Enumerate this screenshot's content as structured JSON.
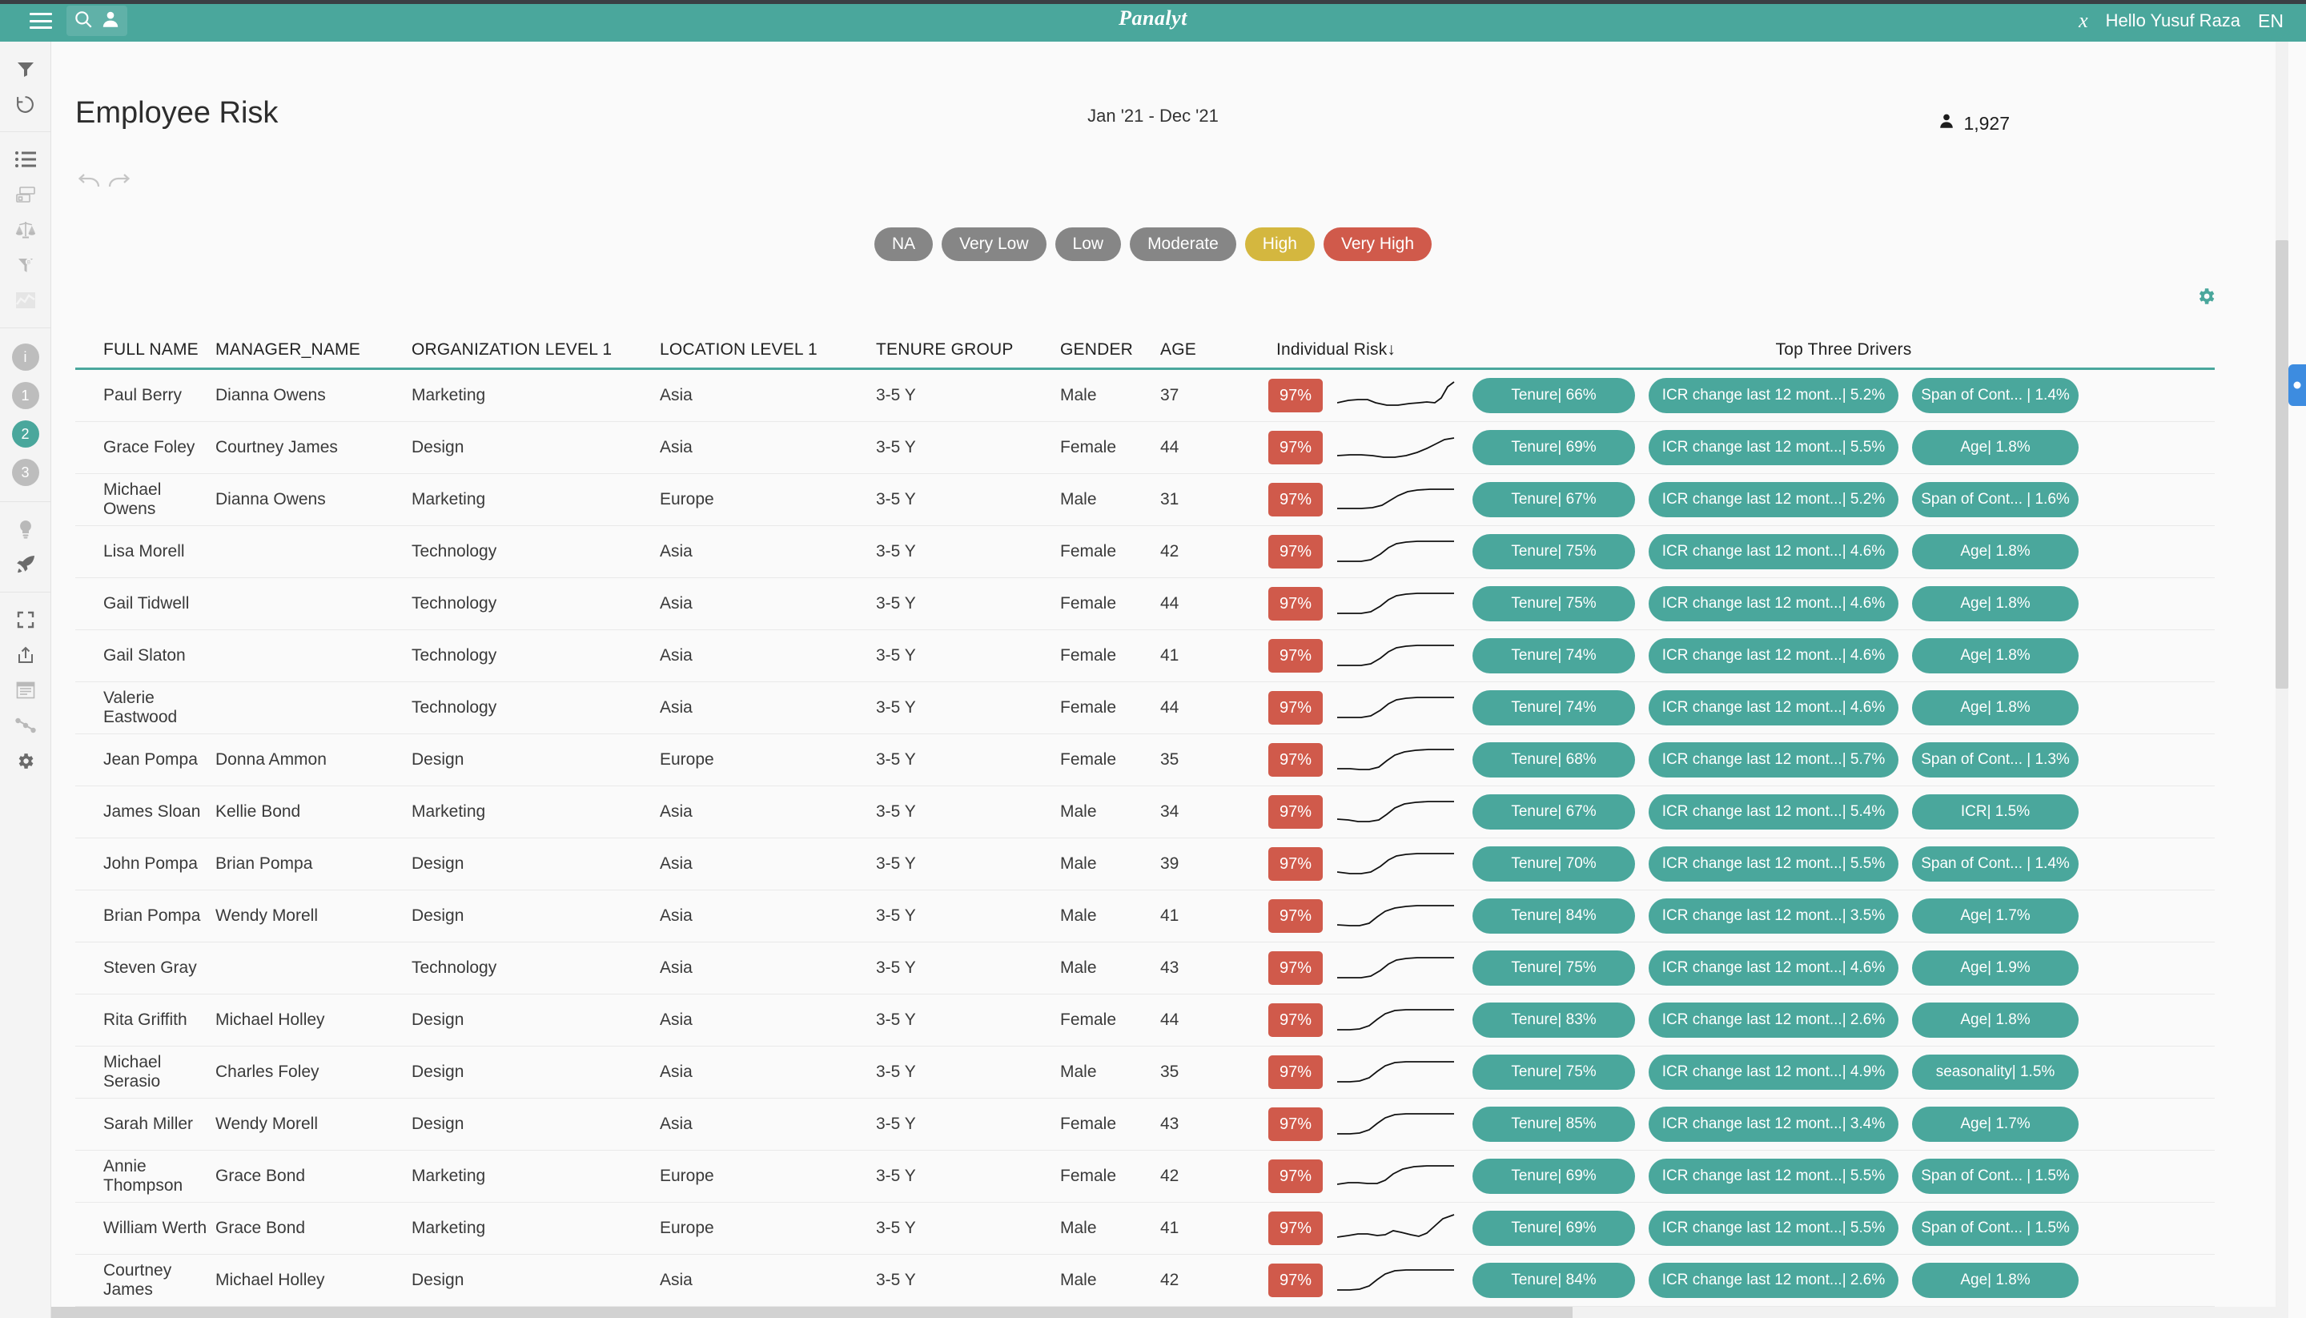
{
  "topbar": {
    "menu_icon": "hamburger-icon",
    "search_icon": "search-icon",
    "user_icon": "user-icon",
    "brand": "Panalyt",
    "leaf_icon": "leaf-icon",
    "greeting": "Hello Yusuf Raza",
    "language": "EN",
    "bg_color": "#4aa79c"
  },
  "rail": {
    "groups": [
      {
        "items": [
          {
            "name": "filter-icon",
            "label": "Filter"
          },
          {
            "name": "history-icon",
            "label": "History"
          }
        ]
      },
      {
        "items": [
          {
            "name": "list-icon",
            "label": "List"
          },
          {
            "name": "cards-icon",
            "label": "Cards"
          },
          {
            "name": "balance-icon",
            "label": "Compare"
          },
          {
            "name": "funnel-b-icon",
            "label": "Benchmark Funnel"
          },
          {
            "name": "chart-area-icon",
            "label": "Trends"
          }
        ]
      },
      {
        "badges": [
          {
            "label": "i",
            "active": false
          },
          {
            "label": "1",
            "active": false
          },
          {
            "label": "2",
            "active": true
          },
          {
            "label": "3",
            "active": false
          }
        ]
      },
      {
        "items": [
          {
            "name": "lightbulb-icon",
            "label": "Insights"
          },
          {
            "name": "rocket-icon",
            "label": "Actions"
          }
        ]
      },
      {
        "items": [
          {
            "name": "fullscreen-icon",
            "label": "Fullscreen"
          },
          {
            "name": "share-icon",
            "label": "Share"
          },
          {
            "name": "report-icon",
            "label": "Report"
          },
          {
            "name": "flow-icon",
            "label": "Flow"
          },
          {
            "name": "gear-icon",
            "label": "Settings"
          }
        ]
      }
    ]
  },
  "header": {
    "title": "Employee Risk",
    "date_range": "Jan '21 - Dec '21",
    "headcount": "1,927",
    "headcount_icon": "person-icon",
    "undo_icon": "undo-icon",
    "redo_icon": "redo-icon",
    "gear_icon": "gear-icon"
  },
  "legend": [
    {
      "label": "NA",
      "color": "#868686"
    },
    {
      "label": "Very Low",
      "color": "#868686"
    },
    {
      "label": "Low",
      "color": "#868686"
    },
    {
      "label": "Moderate",
      "color": "#868686"
    },
    {
      "label": "High",
      "color": "#d4b73f"
    },
    {
      "label": "Very High",
      "color": "#d05a4b"
    }
  ],
  "table": {
    "columns": [
      "FULL NAME",
      "MANAGER_NAME",
      "ORGANIZATION LEVEL 1",
      "LOCATION LEVEL 1",
      "TENURE GROUP",
      "GENDER",
      "AGE",
      "Individual Risk↓",
      "Top Three Drivers"
    ],
    "rows": [
      {
        "full_name": "Paul Berry",
        "manager": "Dianna Owens",
        "org": "Marketing",
        "loc": "Asia",
        "tenure": "3-5 Y",
        "gender": "Male",
        "age": "37",
        "risk": "97%",
        "spark": "0,30 14,27 26,26 38,26 48,30 62,33 76,33 90,31 102,30 112,29 122,30 130,24 138,10 146,4",
        "drivers": [
          "Tenure| 66%",
          "ICR change last 12 mont...| 5.2%",
          "Span of Cont... | 1.4%"
        ]
      },
      {
        "full_name": "Grace Foley",
        "manager": "Courtney James",
        "org": "Design",
        "loc": "Asia",
        "tenure": "3-5 Y",
        "gender": "Female",
        "age": "44",
        "risk": "97%",
        "spark": "0,31 16,30 30,30 44,31 58,33 72,33 86,31 100,27 112,22 124,16 134,11 146,9",
        "drivers": [
          "Tenure| 69%",
          "ICR change last 12 mont...| 5.5%",
          "Age| 1.8%"
        ]
      },
      {
        "full_name": "Michael Owens",
        "manager": "Dianna Owens",
        "org": "Marketing",
        "loc": "Europe",
        "tenure": "3-5 Y",
        "gender": "Male",
        "age": "31",
        "risk": "97%",
        "spark": "0,32 16,32 30,32 44,31 56,28 66,22 76,16 88,11 100,9 116,8 130,8 146,8",
        "drivers": [
          "Tenure| 67%",
          "ICR change last 12 mont...| 5.2%",
          "Span of Cont... | 1.6%"
        ]
      },
      {
        "full_name": "Lisa Morell",
        "manager": "",
        "org": "Technology",
        "loc": "Asia",
        "tenure": "3-5 Y",
        "gender": "Female",
        "age": "42",
        "risk": "97%",
        "spark": "0,33 16,33 30,33 42,31 54,24 64,16 74,11 86,9 100,8 116,8 130,8 146,8",
        "drivers": [
          "Tenure| 75%",
          "ICR change last 12 mont...| 4.6%",
          "Age| 1.8%"
        ]
      },
      {
        "full_name": "Gail Tidwell",
        "manager": "",
        "org": "Technology",
        "loc": "Asia",
        "tenure": "3-5 Y",
        "gender": "Female",
        "age": "44",
        "risk": "97%",
        "spark": "0,33 16,33 30,33 42,31 54,24 64,16 74,11 86,9 100,8 116,8 130,8 146,8",
        "drivers": [
          "Tenure| 75%",
          "ICR change last 12 mont...| 4.6%",
          "Age| 1.8%"
        ]
      },
      {
        "full_name": "Gail Slaton",
        "manager": "",
        "org": "Technology",
        "loc": "Asia",
        "tenure": "3-5 Y",
        "gender": "Female",
        "age": "41",
        "risk": "97%",
        "spark": "0,33 16,33 30,33 42,31 54,24 64,16 74,11 86,9 100,8 116,8 130,8 146,8",
        "drivers": [
          "Tenure| 74%",
          "ICR change last 12 mont...| 4.6%",
          "Age| 1.8%"
        ]
      },
      {
        "full_name": "Valerie Eastwood",
        "manager": "",
        "org": "Technology",
        "loc": "Asia",
        "tenure": "3-5 Y",
        "gender": "Female",
        "age": "44",
        "risk": "97%",
        "spark": "0,33 16,33 30,33 42,31 54,24 64,16 74,11 86,9 100,8 116,8 130,8 146,8",
        "drivers": [
          "Tenure| 74%",
          "ICR change last 12 mont...| 4.6%",
          "Age| 1.8%"
        ]
      },
      {
        "full_name": "Jean Pompa",
        "manager": "Donna Ammon",
        "org": "Design",
        "loc": "Europe",
        "tenure": "3-5 Y",
        "gender": "Female",
        "age": "35",
        "risk": "97%",
        "spark": "0,32 16,32 28,33 40,33 52,30 62,22 72,15 84,11 98,9 114,8 130,8 146,8",
        "drivers": [
          "Tenure| 68%",
          "ICR change last 12 mont...| 5.7%",
          "Span of Cont... | 1.3%"
        ]
      },
      {
        "full_name": "James Sloan",
        "manager": "Kellie Bond",
        "org": "Marketing",
        "loc": "Asia",
        "tenure": "3-5 Y",
        "gender": "Male",
        "age": "34",
        "risk": "97%",
        "spark": "0,30 14,31 26,33 40,33 52,31 62,24 72,16 84,11 98,9 114,8 130,8 146,8",
        "drivers": [
          "Tenure| 67%",
          "ICR change last 12 mont...| 5.4%",
          "ICR| 1.5%"
        ]
      },
      {
        "full_name": "John Pompa",
        "manager": "Brian Pompa",
        "org": "Design",
        "loc": "Asia",
        "tenure": "3-5 Y",
        "gender": "Male",
        "age": "39",
        "risk": "97%",
        "spark": "0,31 16,33 30,33 42,31 54,24 64,16 74,11 86,9 100,8 116,8 130,8 146,8",
        "drivers": [
          "Tenure| 70%",
          "ICR change last 12 mont...| 5.5%",
          "Span of Cont... | 1.4%"
        ]
      },
      {
        "full_name": "Brian Pompa",
        "manager": "Wendy Morell",
        "org": "Design",
        "loc": "Asia",
        "tenure": "3-5 Y",
        "gender": "Male",
        "age": "41",
        "risk": "97%",
        "spark": "0,32 16,33 28,33 40,30 50,22 60,15 72,11 86,9 100,8 116,8 130,8 146,8",
        "drivers": [
          "Tenure| 84%",
          "ICR change last 12 mont...| 3.5%",
          "Age| 1.7%"
        ]
      },
      {
        "full_name": "Steven Gray",
        "manager": "",
        "org": "Technology",
        "loc": "Asia",
        "tenure": "3-5 Y",
        "gender": "Male",
        "age": "43",
        "risk": "97%",
        "spark": "0,33 16,33 30,33 42,31 54,24 64,16 74,11 86,9 100,8 116,8 130,8 146,8",
        "drivers": [
          "Tenure| 75%",
          "ICR change last 12 mont...| 4.6%",
          "Age| 1.9%"
        ]
      },
      {
        "full_name": "Rita Griffith",
        "manager": "Michael Holley",
        "org": "Design",
        "loc": "Asia",
        "tenure": "3-5 Y",
        "gender": "Female",
        "age": "44",
        "risk": "97%",
        "spark": "0,33 16,33 28,32 40,28 50,20 60,13 72,9 86,8 100,8 116,8 130,8 146,8",
        "drivers": [
          "Tenure| 83%",
          "ICR change last 12 mont...| 2.6%",
          "Age| 1.8%"
        ]
      },
      {
        "full_name": "Michael Serasio",
        "manager": "Charles Foley",
        "org": "Design",
        "loc": "Asia",
        "tenure": "3-5 Y",
        "gender": "Male",
        "age": "35",
        "risk": "97%",
        "spark": "0,33 16,33 28,32 40,28 50,20 60,13 72,9 86,8 100,8 116,8 130,8 146,8",
        "drivers": [
          "Tenure| 75%",
          "ICR change last 12 mont...| 4.9%",
          "seasonality| 1.5%"
        ]
      },
      {
        "full_name": "Sarah Miller",
        "manager": "Wendy Morell",
        "org": "Design",
        "loc": "Asia",
        "tenure": "3-5 Y",
        "gender": "Female",
        "age": "43",
        "risk": "97%",
        "spark": "0,33 16,33 28,32 40,28 50,20 60,13 72,9 86,8 100,8 116,8 130,8 146,8",
        "drivers": [
          "Tenure| 85%",
          "ICR change last 12 mont...| 3.4%",
          "Age| 1.7%"
        ]
      },
      {
        "full_name": "Annie Thompson",
        "manager": "Grace Bond",
        "org": "Marketing",
        "loc": "Europe",
        "tenure": "3-5 Y",
        "gender": "Female",
        "age": "42",
        "risk": "97%",
        "spark": "0,31 14,29 26,29 38,30 50,30 60,26 70,18 82,12 96,9 112,8 130,8 146,8",
        "drivers": [
          "Tenure| 69%",
          "ICR change last 12 mont...| 5.5%",
          "Span of Cont... | 1.5%"
        ]
      },
      {
        "full_name": "William Werth",
        "manager": "Grace Bond",
        "org": "Marketing",
        "loc": "Europe",
        "tenure": "3-5 Y",
        "gender": "Male",
        "age": "41",
        "risk": "97%",
        "spark": "0,32 14,30 26,28 38,28 50,30 60,29 70,24 80,26 92,29 102,31 112,27 122,18 132,9 146,4",
        "drivers": [
          "Tenure| 69%",
          "ICR change last 12 mont...| 5.5%",
          "Span of Cont... | 1.5%"
        ]
      },
      {
        "full_name": "Courtney James",
        "manager": "Michael Holley",
        "org": "Design",
        "loc": "Asia",
        "tenure": "3-5 Y",
        "gender": "Male",
        "age": "42",
        "risk": "97%",
        "spark": "0,33 16,33 28,32 40,28 50,20 60,13 72,9 86,8 100,8 116,8 130,8 146,8",
        "drivers": [
          "Tenure| 84%",
          "ICR change last 12 mont...| 2.6%",
          "Age| 1.8%"
        ]
      }
    ]
  },
  "colors": {
    "accent": "#4aa79c",
    "risk_high": "#d05a4b",
    "risk_warn": "#d4b73f",
    "neutral": "#868686"
  }
}
